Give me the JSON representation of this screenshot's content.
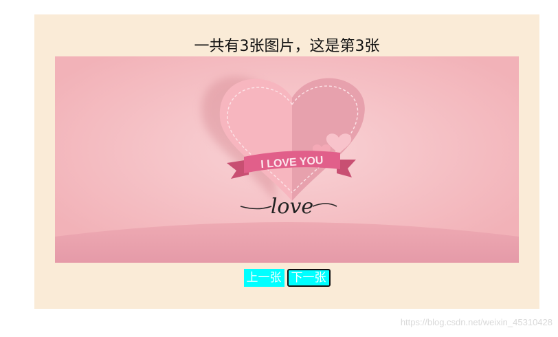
{
  "carousel": {
    "title": "一共有3张图片，这是第3张",
    "image": {
      "ribbon_text": "I LOVE YOU",
      "script_text": "love"
    },
    "prev_label": "上一张",
    "next_label": "下一张"
  },
  "watermark": "https://blog.csdn.net/weixin_45310428",
  "colors": {
    "panel_bg": "#faebd7",
    "button_bg": "#00ffff",
    "button_text": "#ffffff",
    "image_bg": "#f5bcc0"
  }
}
